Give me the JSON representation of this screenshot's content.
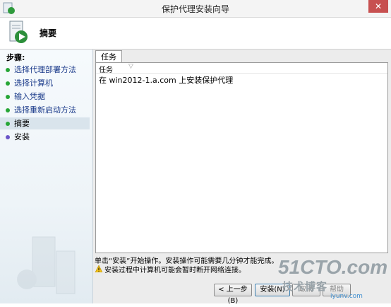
{
  "window": {
    "title": "保护代理安装向导",
    "close_glyph": "✕"
  },
  "header": {
    "title": "摘要"
  },
  "steps": {
    "heading": "步骤:",
    "items": [
      {
        "label": "选择代理部署方法",
        "state": "done"
      },
      {
        "label": "选择计算机",
        "state": "done"
      },
      {
        "label": "输入凭据",
        "state": "done"
      },
      {
        "label": "选择重新启动方法",
        "state": "done"
      },
      {
        "label": "摘要",
        "state": "current"
      },
      {
        "label": "安装",
        "state": "future"
      }
    ]
  },
  "tasks": {
    "tab_label": "任务",
    "column_header": "任务",
    "sort_glyph": "▽",
    "rows": [
      "在 win2012-1.a.com 上安装保护代理"
    ]
  },
  "info_text": "单击“安装”开始操作。安装操作可能需要几分钟才能完成。",
  "warning_text": "安装过程中计算机可能会暂时断开网络连接。",
  "buttons": {
    "back": "< 上一步(B)",
    "install": "安装(N)",
    "cancel": "取消",
    "help": "帮助"
  },
  "watermark": {
    "main": "51CTO.com",
    "sub": "技术博客",
    "site": "iyunv.com"
  },
  "colors": {
    "done": "#27a637",
    "current": "#27a637",
    "future": "#6b55c8",
    "link": "#1a3a8a"
  }
}
